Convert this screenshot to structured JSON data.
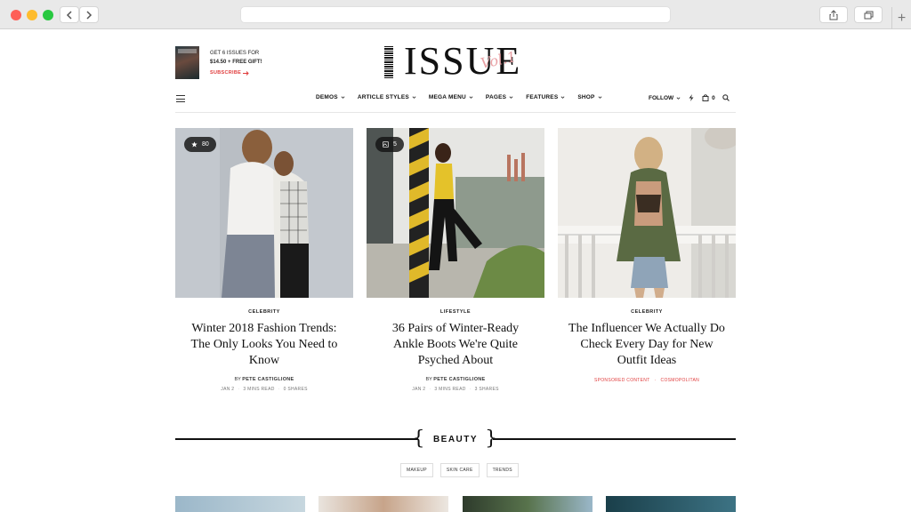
{
  "promo": {
    "line1": "GET 6 ISSUES FOR",
    "line2": "$14.50 + FREE GIFT!",
    "cta": "SUBSCRIBE"
  },
  "logo": {
    "main": "ISSUE",
    "script": "Vol.1"
  },
  "nav": {
    "items": [
      "DEMOS",
      "ARTICLE STYLES",
      "MEGA MENU",
      "PAGES",
      "FEATURES",
      "SHOP"
    ],
    "follow": "FOLLOW",
    "cart_count": "0"
  },
  "articles": [
    {
      "badge": "80",
      "badge_icon": "star-icon",
      "category": "CELEBRITY",
      "title": "Winter 2018 Fashion Trends: The Only Looks You Need to Know",
      "by": "BY",
      "author": "PETE CASTIGLIONE",
      "date": "JAN 2",
      "read": "3 MINS READ",
      "shares": "0 SHARES"
    },
    {
      "badge": "5",
      "badge_icon": "gallery-icon",
      "category": "LIFESTYLE",
      "title": "36 Pairs of Winter-Ready Ankle Boots We're Quite Psyched About",
      "by": "BY",
      "author": "PETE CASTIGLIONE",
      "date": "JAN 2",
      "read": "3 MINS READ",
      "shares": "3 SHARES"
    },
    {
      "category": "CELEBRITY",
      "title": "The Influencer We Actually Do Check Every Day for New Outfit Ideas",
      "sponsored": "SPONSORED CONTENT",
      "sponsor": "COSMOPOLITAN"
    }
  ],
  "section": {
    "title": "BEAUTY",
    "tags": [
      "MAKEUP",
      "SKIN CARE",
      "TRENDS"
    ]
  },
  "colors": {
    "accent": "#e03c3c",
    "text": "#111111"
  }
}
